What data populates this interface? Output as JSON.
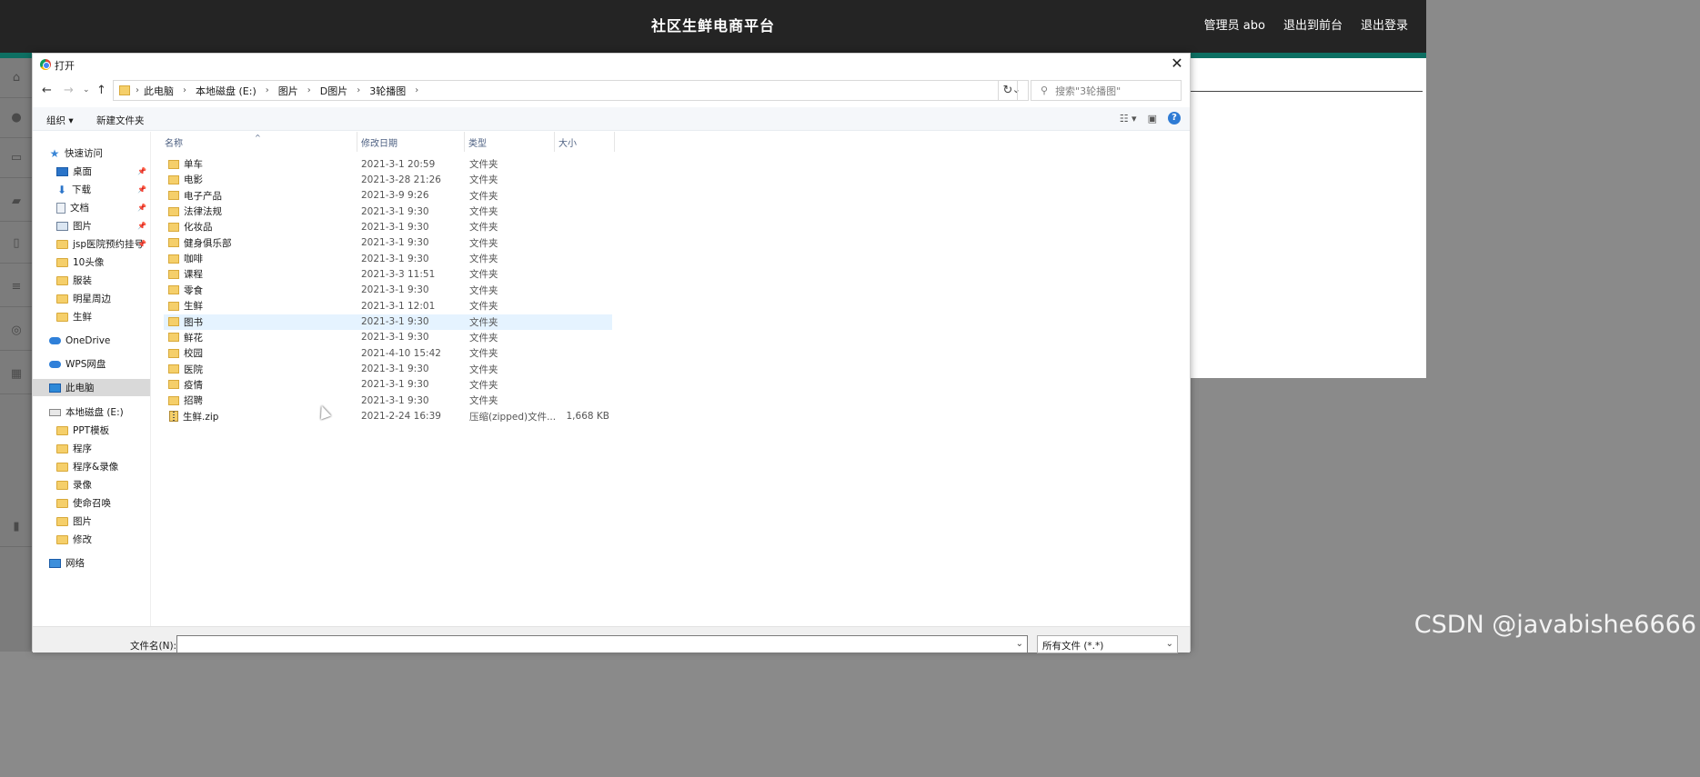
{
  "app": {
    "title": "社区生鲜电商平台",
    "nav": [
      "管理员 abo",
      "退出到前台",
      "退出登录"
    ],
    "left_rail_icons": [
      "home-icon",
      "user-icon",
      "monitor-icon",
      "briefcase-icon",
      "phone-icon",
      "list-icon",
      "compass-icon",
      "grid-icon",
      "chart-icon"
    ],
    "accent": "#0d6f62"
  },
  "dialog": {
    "title": "打开",
    "breadcrumbs": [
      "此电脑",
      "本地磁盘 (E:)",
      "图片",
      "D图片",
      "3轮播图"
    ],
    "search_placeholder": "搜索\"3轮播图\"",
    "toolbar": {
      "organize": "组织 ▾",
      "new_folder": "新建文件夹"
    },
    "nav_pane": [
      {
        "label": "快速访问",
        "icon": "star-icon",
        "kind": "star"
      },
      {
        "label": "桌面",
        "icon": "desktop-icon",
        "kind": "blue",
        "pinned": true
      },
      {
        "label": "下载",
        "icon": "download-icon",
        "kind": "dl",
        "pinned": true
      },
      {
        "label": "文档",
        "icon": "document-icon",
        "kind": "doc",
        "pinned": true
      },
      {
        "label": "图片",
        "icon": "pictures-icon",
        "kind": "img",
        "pinned": true
      },
      {
        "label": "jsp医院预约挂号",
        "icon": "folder-icon",
        "kind": "f",
        "pinned": true
      },
      {
        "label": "10头像",
        "icon": "folder-icon",
        "kind": "f"
      },
      {
        "label": "服装",
        "icon": "folder-icon",
        "kind": "f"
      },
      {
        "label": "明星周边",
        "icon": "folder-icon",
        "kind": "f"
      },
      {
        "label": "生鲜",
        "icon": "folder-icon",
        "kind": "f"
      },
      {
        "label": "OneDrive",
        "icon": "onedrive-icon",
        "kind": "cloud"
      },
      {
        "label": "WPS网盘",
        "icon": "wps-cloud-icon",
        "kind": "cloud"
      },
      {
        "label": "此电脑",
        "icon": "computer-icon",
        "kind": "pc",
        "selected": true
      },
      {
        "label": "本地磁盘 (E:)",
        "icon": "drive-icon",
        "kind": "drive"
      },
      {
        "label": "PPT模板",
        "icon": "folder-icon",
        "kind": "f"
      },
      {
        "label": "程序",
        "icon": "folder-icon",
        "kind": "f"
      },
      {
        "label": "程序&录像",
        "icon": "folder-icon",
        "kind": "f"
      },
      {
        "label": "录像",
        "icon": "folder-icon",
        "kind": "f"
      },
      {
        "label": "使命召唤",
        "icon": "folder-icon",
        "kind": "f"
      },
      {
        "label": "图片",
        "icon": "folder-icon",
        "kind": "f"
      },
      {
        "label": "修改",
        "icon": "folder-icon",
        "kind": "f"
      },
      {
        "label": "网络",
        "icon": "network-icon",
        "kind": "net"
      }
    ],
    "columns": [
      "名称",
      "修改日期",
      "类型",
      "大小"
    ],
    "files": [
      {
        "name": "单车",
        "date": "2021-3-1 20:59",
        "type": "文件夹",
        "size": ""
      },
      {
        "name": "电影",
        "date": "2021-3-28 21:26",
        "type": "文件夹",
        "size": ""
      },
      {
        "name": "电子产品",
        "date": "2021-3-9 9:26",
        "type": "文件夹",
        "size": ""
      },
      {
        "name": "法律法规",
        "date": "2021-3-1 9:30",
        "type": "文件夹",
        "size": ""
      },
      {
        "name": "化妆品",
        "date": "2021-3-1 9:30",
        "type": "文件夹",
        "size": ""
      },
      {
        "name": "健身俱乐部",
        "date": "2021-3-1 9:30",
        "type": "文件夹",
        "size": ""
      },
      {
        "name": "咖啡",
        "date": "2021-3-1 9:30",
        "type": "文件夹",
        "size": ""
      },
      {
        "name": "课程",
        "date": "2021-3-3 11:51",
        "type": "文件夹",
        "size": ""
      },
      {
        "name": "零食",
        "date": "2021-3-1 9:30",
        "type": "文件夹",
        "size": ""
      },
      {
        "name": "生鲜",
        "date": "2021-3-1 12:01",
        "type": "文件夹",
        "size": ""
      },
      {
        "name": "图书",
        "date": "2021-3-1 9:30",
        "type": "文件夹",
        "size": "",
        "hover": true
      },
      {
        "name": "鲜花",
        "date": "2021-3-1 9:30",
        "type": "文件夹",
        "size": ""
      },
      {
        "name": "校园",
        "date": "2021-4-10 15:42",
        "type": "文件夹",
        "size": ""
      },
      {
        "name": "医院",
        "date": "2021-3-1 9:30",
        "type": "文件夹",
        "size": ""
      },
      {
        "name": "疫情",
        "date": "2021-3-1 9:30",
        "type": "文件夹",
        "size": ""
      },
      {
        "name": "招聘",
        "date": "2021-3-1 9:30",
        "type": "文件夹",
        "size": ""
      },
      {
        "name": "生鲜.zip",
        "date": "2021-2-24 16:39",
        "type": "压缩(zipped)文件...",
        "size": "1,668 KB",
        "zip": true
      }
    ],
    "filename_label": "文件名(N):",
    "filename_value": "",
    "filetype_value": "所有文件 (*.*)"
  },
  "watermark": "CSDN @javabishe6666"
}
